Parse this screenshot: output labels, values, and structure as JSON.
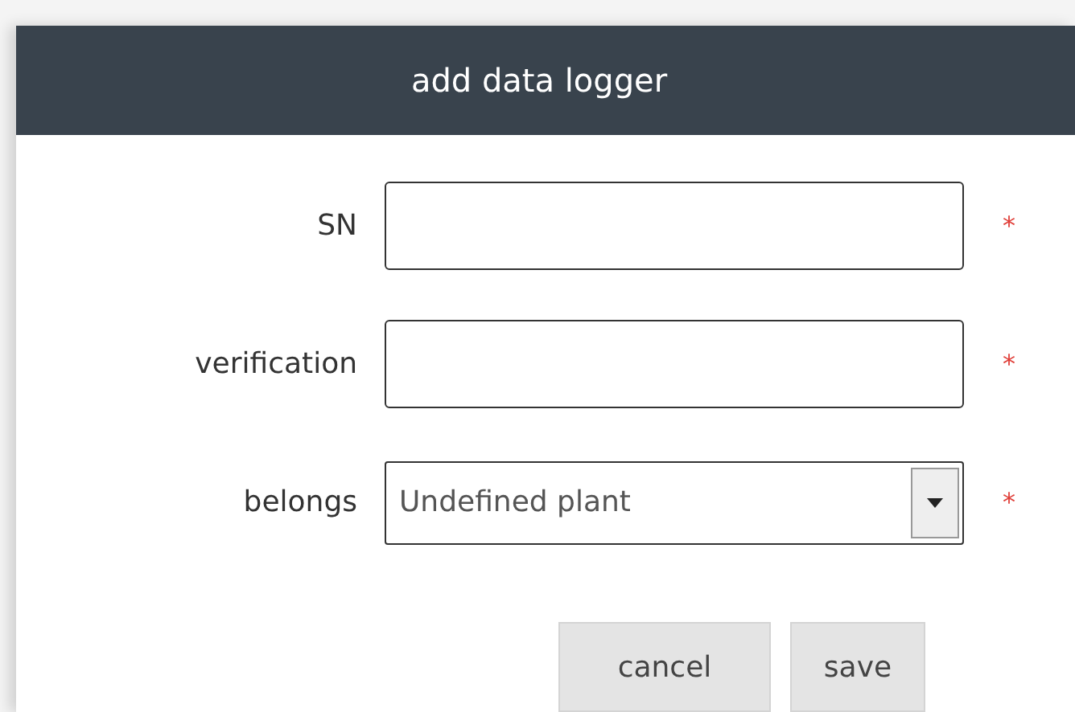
{
  "dialog": {
    "title": "add data logger",
    "fields": [
      {
        "kind": "text",
        "label": "SN",
        "required": true
      },
      {
        "kind": "text",
        "label": "verification",
        "required": true
      },
      {
        "kind": "select",
        "label": "belongs",
        "value": "Undefined plant",
        "required": true
      }
    ],
    "required_mark": "*",
    "buttons": [
      {
        "label": "cancel"
      },
      {
        "label": "save"
      }
    ]
  }
}
